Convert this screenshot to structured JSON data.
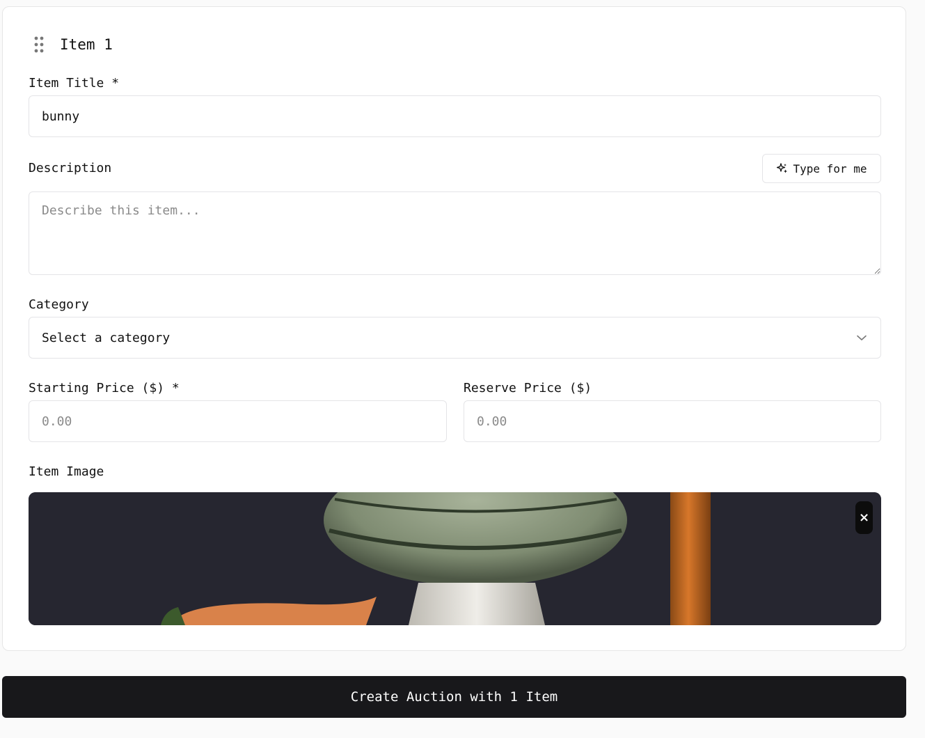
{
  "item": {
    "heading": "Item 1",
    "drag_icon": "grip-vertical-icon"
  },
  "fields": {
    "title": {
      "label": "Item Title *",
      "value": "bunny"
    },
    "description": {
      "label": "Description",
      "placeholder": "Describe this item...",
      "value": "",
      "assist_button": "Type for me",
      "assist_icon": "sparkles-icon"
    },
    "category": {
      "label": "Category",
      "selected": "Select a category",
      "icon": "chevron-down-icon"
    },
    "starting_price": {
      "label": "Starting Price ($) *",
      "placeholder": "0.00",
      "value": ""
    },
    "reserve_price": {
      "label": "Reserve Price ($)",
      "placeholder": "0.00",
      "value": ""
    },
    "image": {
      "label": "Item Image",
      "remove_label": "×",
      "remove_icon": "close-icon"
    }
  },
  "submit": {
    "label": "Create Auction with 1 Item"
  },
  "colors": {
    "primary": "#18181b",
    "border": "#e4e4e7",
    "image_bg": "#272730"
  }
}
